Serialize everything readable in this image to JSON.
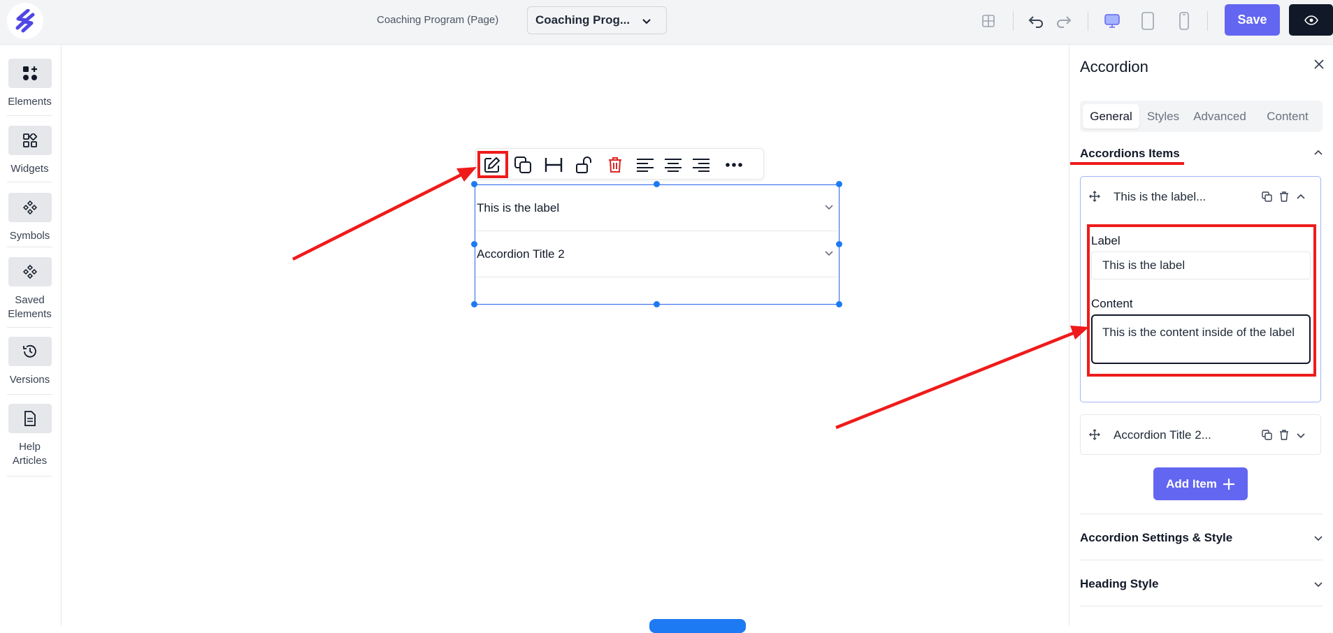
{
  "header": {
    "page_label": "Coaching Program (Page)",
    "page_select_value": "Coaching Prog...",
    "save_label": "Save"
  },
  "left_sidebar": {
    "items": [
      {
        "label": "Elements",
        "icon": "elements-icon"
      },
      {
        "label": "Widgets",
        "icon": "widgets-icon"
      },
      {
        "label": "Symbols",
        "icon": "symbols-icon"
      },
      {
        "label": "Saved Elements",
        "icon": "saved-elements-icon"
      },
      {
        "label": "Versions",
        "icon": "history-icon"
      },
      {
        "label": "Help Articles",
        "icon": "document-icon"
      }
    ]
  },
  "canvas": {
    "accordion_items": [
      "This is the label",
      "Accordion Title 2"
    ]
  },
  "right_panel": {
    "title": "Accordion",
    "tabs": [
      "General",
      "Styles",
      "Advanced",
      "Content"
    ],
    "active_tab": "General",
    "section_items_title": "Accordions Items",
    "item1": {
      "title": "This is the label...",
      "label_field_title": "Label",
      "label_value": "This is the label",
      "content_field_title": "Content",
      "content_value": "This is the content inside of the label"
    },
    "item2": {
      "title": "Accordion Title 2..."
    },
    "add_item_label": "Add Item",
    "section_settings_title": "Accordion Settings & Style",
    "section_heading_title": "Heading Style"
  },
  "colors": {
    "accent": "#6366f1",
    "selection": "#1d7af3",
    "annotation": "#ef1b1b",
    "delete": "#dc2626"
  }
}
